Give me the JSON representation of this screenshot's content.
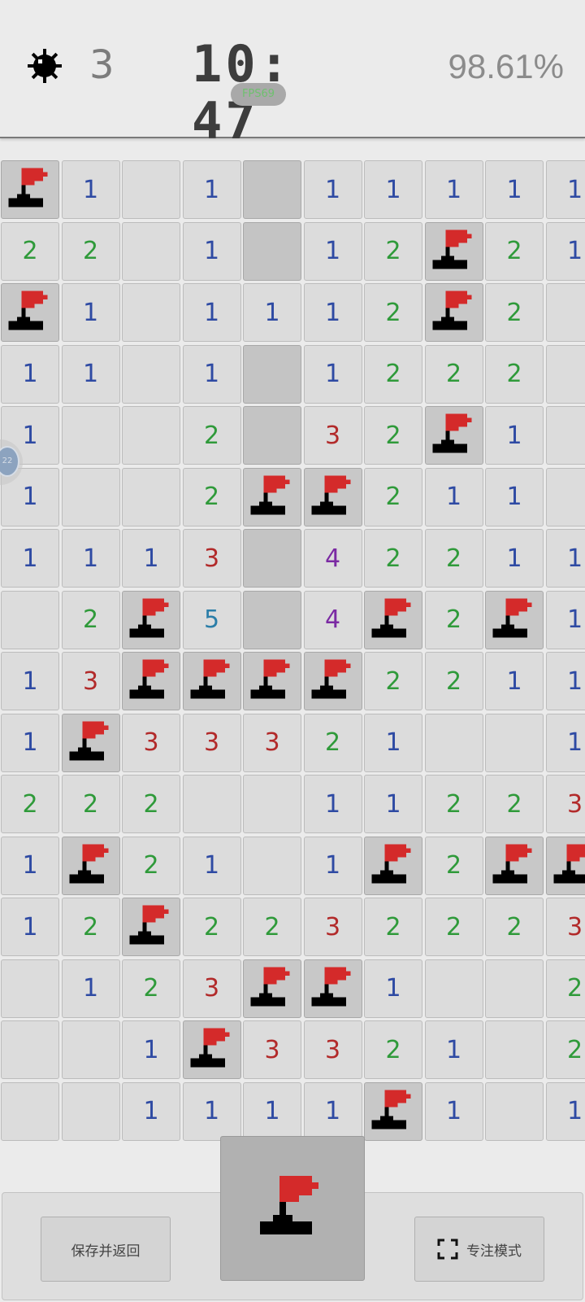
{
  "header": {
    "mines_remaining": "3",
    "timer": "10: 47",
    "fps": "FPS69",
    "progress_percent": "98.61%",
    "icon": "mine-icon"
  },
  "board": {
    "columns_visible": 10,
    "rows": [
      [
        "F",
        "1",
        "",
        "1",
        "H",
        "1",
        "1",
        "1",
        "1",
        "1"
      ],
      [
        "2",
        "2",
        "",
        "1",
        "H",
        "1",
        "2",
        "F",
        "2",
        "1"
      ],
      [
        "F",
        "1",
        "",
        "1",
        "1",
        "1",
        "2",
        "F",
        "2",
        ""
      ],
      [
        "1",
        "1",
        "",
        "1",
        "H",
        "1",
        "2",
        "2",
        "2",
        ""
      ],
      [
        "1",
        "",
        "",
        "2",
        "H",
        "3",
        "2",
        "F",
        "1",
        ""
      ],
      [
        "1",
        "",
        "",
        "2",
        "F",
        "F",
        "2",
        "1",
        "1",
        ""
      ],
      [
        "1",
        "1",
        "1",
        "3",
        "H",
        "4",
        "2",
        "2",
        "1",
        "1"
      ],
      [
        "",
        "2",
        "F",
        "5",
        "H",
        "4",
        "F",
        "2",
        "F",
        "1"
      ],
      [
        "1",
        "3",
        "F",
        "F",
        "F",
        "F",
        "2",
        "2",
        "1",
        "1"
      ],
      [
        "1",
        "F",
        "3",
        "3",
        "3",
        "2",
        "1",
        "",
        "",
        "1"
      ],
      [
        "2",
        "2",
        "2",
        "",
        "",
        "1",
        "1",
        "2",
        "2",
        "3"
      ],
      [
        "1",
        "F",
        "2",
        "1",
        "",
        "1",
        "F",
        "2",
        "F",
        "F"
      ],
      [
        "1",
        "2",
        "F",
        "2",
        "2",
        "3",
        "2",
        "2",
        "2",
        "3"
      ],
      [
        "",
        "1",
        "2",
        "3",
        "F",
        "F",
        "1",
        "",
        "",
        "2"
      ],
      [
        "",
        "",
        "1",
        "F",
        "3",
        "3",
        "2",
        "1",
        "",
        "2"
      ],
      [
        "",
        "",
        "1",
        "1",
        "1",
        "1",
        "F",
        "1",
        "",
        "1"
      ]
    ],
    "legend": {
      "F": "flag",
      "H": "unrevealed"
    },
    "colors": {
      "1": "#2e4aa3",
      "2": "#2f9a3a",
      "3": "#b22a2a",
      "4": "#7b2aa3",
      "5": "#2b7ea8"
    }
  },
  "floating_handle": {
    "label": "22"
  },
  "bottom": {
    "save_label": "保存并返回",
    "focus_label": "专注模式",
    "flag_mode_icon": "flag-icon",
    "focus_icon": "fullscreen-icon"
  }
}
